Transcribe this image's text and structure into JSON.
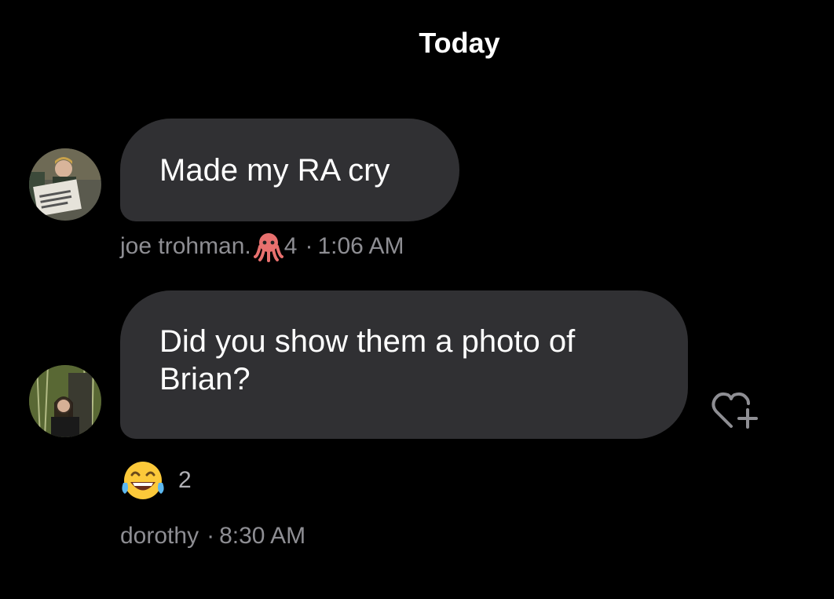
{
  "date_header": "Today",
  "messages": [
    {
      "text": "Made my RA cry",
      "sender": "joe trohman.",
      "sender_badge_icon": "octopus-emoji",
      "sender_badge_count": "4",
      "separator": "·",
      "time": "1:06 AM"
    },
    {
      "text_lines": [
        "Did you show them a photo of",
        "Brian?"
      ],
      "sender": "dorothy",
      "separator": "·",
      "time": "8:30 AM",
      "reaction": {
        "icon": "laughing-tears-emoji",
        "count": "2"
      },
      "action_icon": "heart-add-icon"
    }
  ],
  "colors": {
    "background": "#000000",
    "bubble": "#303033",
    "meta_text": "#8e8e93"
  }
}
